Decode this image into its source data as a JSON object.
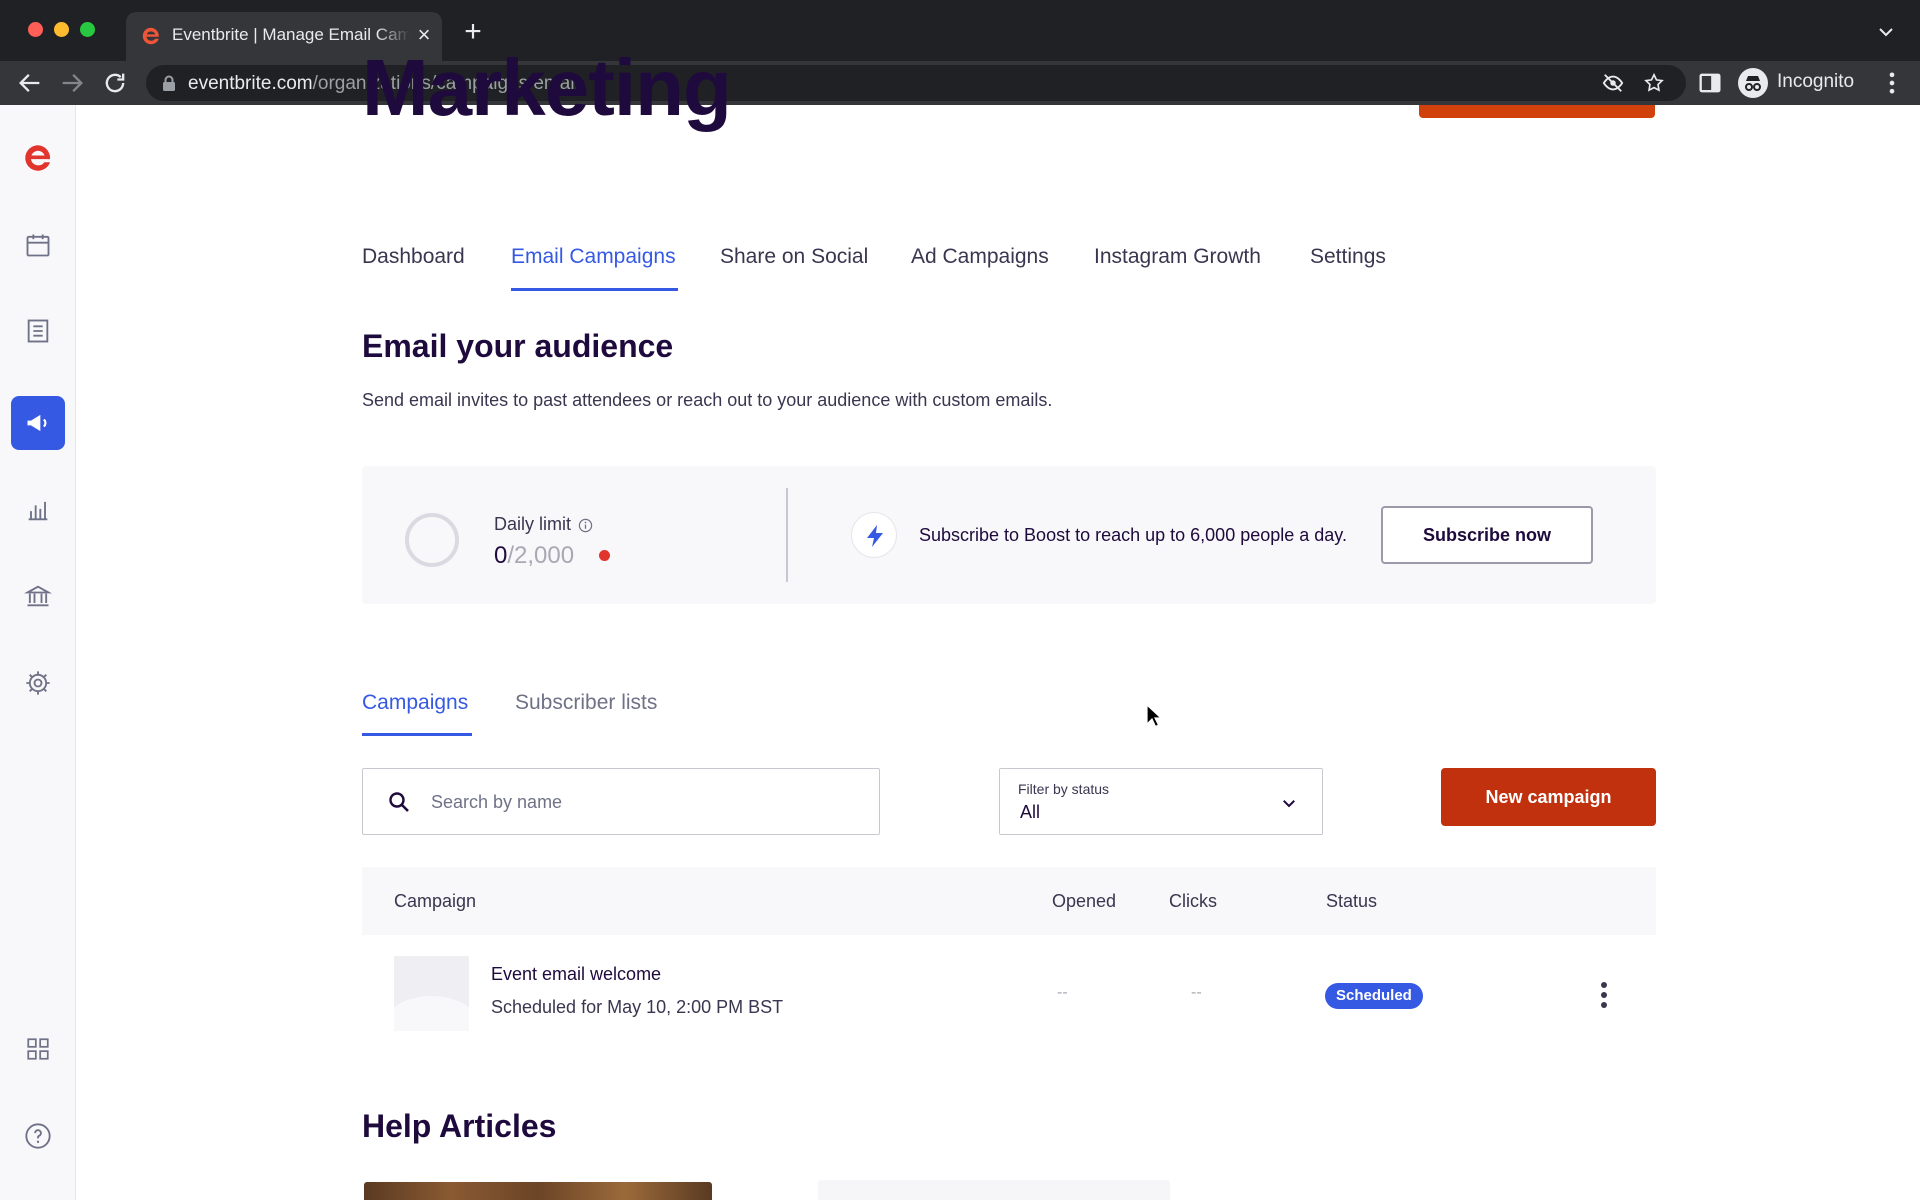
{
  "browser": {
    "tab_title": "Eventbrite | Manage Email Campaigns",
    "tab_close": "×",
    "new_tab": "+",
    "url_host": "eventbrite.com",
    "url_path": "/organizations/campaigns/email",
    "profile_label": "Incognito"
  },
  "sidebar": {
    "items": [
      {
        "icon": "eventbrite-logo-icon"
      },
      {
        "icon": "calendar-icon"
      },
      {
        "icon": "orders-list-icon"
      },
      {
        "icon": "megaphone-icon",
        "active": true
      },
      {
        "icon": "reports-chart-icon"
      },
      {
        "icon": "finance-bank-icon"
      },
      {
        "icon": "settings-gear-icon"
      },
      {
        "icon": "apps-grid-icon"
      },
      {
        "icon": "help-icon"
      }
    ]
  },
  "page": {
    "heading": "Marketing",
    "tabs": [
      {
        "label": "Dashboard"
      },
      {
        "label": "Email Campaigns",
        "active": true
      },
      {
        "label": "Share on Social"
      },
      {
        "label": "Ad Campaigns"
      },
      {
        "label": "Instagram Growth"
      },
      {
        "label": "Settings"
      }
    ]
  },
  "email": {
    "title": "Email your audience",
    "description": "Send email invites to past attendees or reach out to your audience with custom emails.",
    "daily_limit": {
      "label": "Daily limit",
      "used": "0",
      "total": "/2,000"
    },
    "boost": {
      "text": "Subscribe to Boost to reach up to 6,000 people a day.",
      "button": "Subscribe now"
    }
  },
  "subtabs": [
    {
      "label": "Campaigns",
      "active": true
    },
    {
      "label": "Subscriber lists"
    }
  ],
  "search": {
    "placeholder": "Search by name",
    "value": ""
  },
  "filter": {
    "label": "Filter by status",
    "value": "All"
  },
  "new_campaign_label": "New campaign",
  "table": {
    "columns": [
      "Campaign",
      "Opened",
      "Clicks",
      "Status"
    ],
    "rows": [
      {
        "name": "Event email welcome",
        "subtitle": "Scheduled for May 10, 2:00 PM BST",
        "opened": "--",
        "clicks": "--",
        "status": "Scheduled"
      }
    ]
  },
  "help": {
    "title": "Help Articles"
  },
  "colors": {
    "accent": "#3659e3",
    "brand_orange": "#d1410c",
    "primary_button": "#c1310e",
    "text_dark": "#1e0a3c"
  }
}
